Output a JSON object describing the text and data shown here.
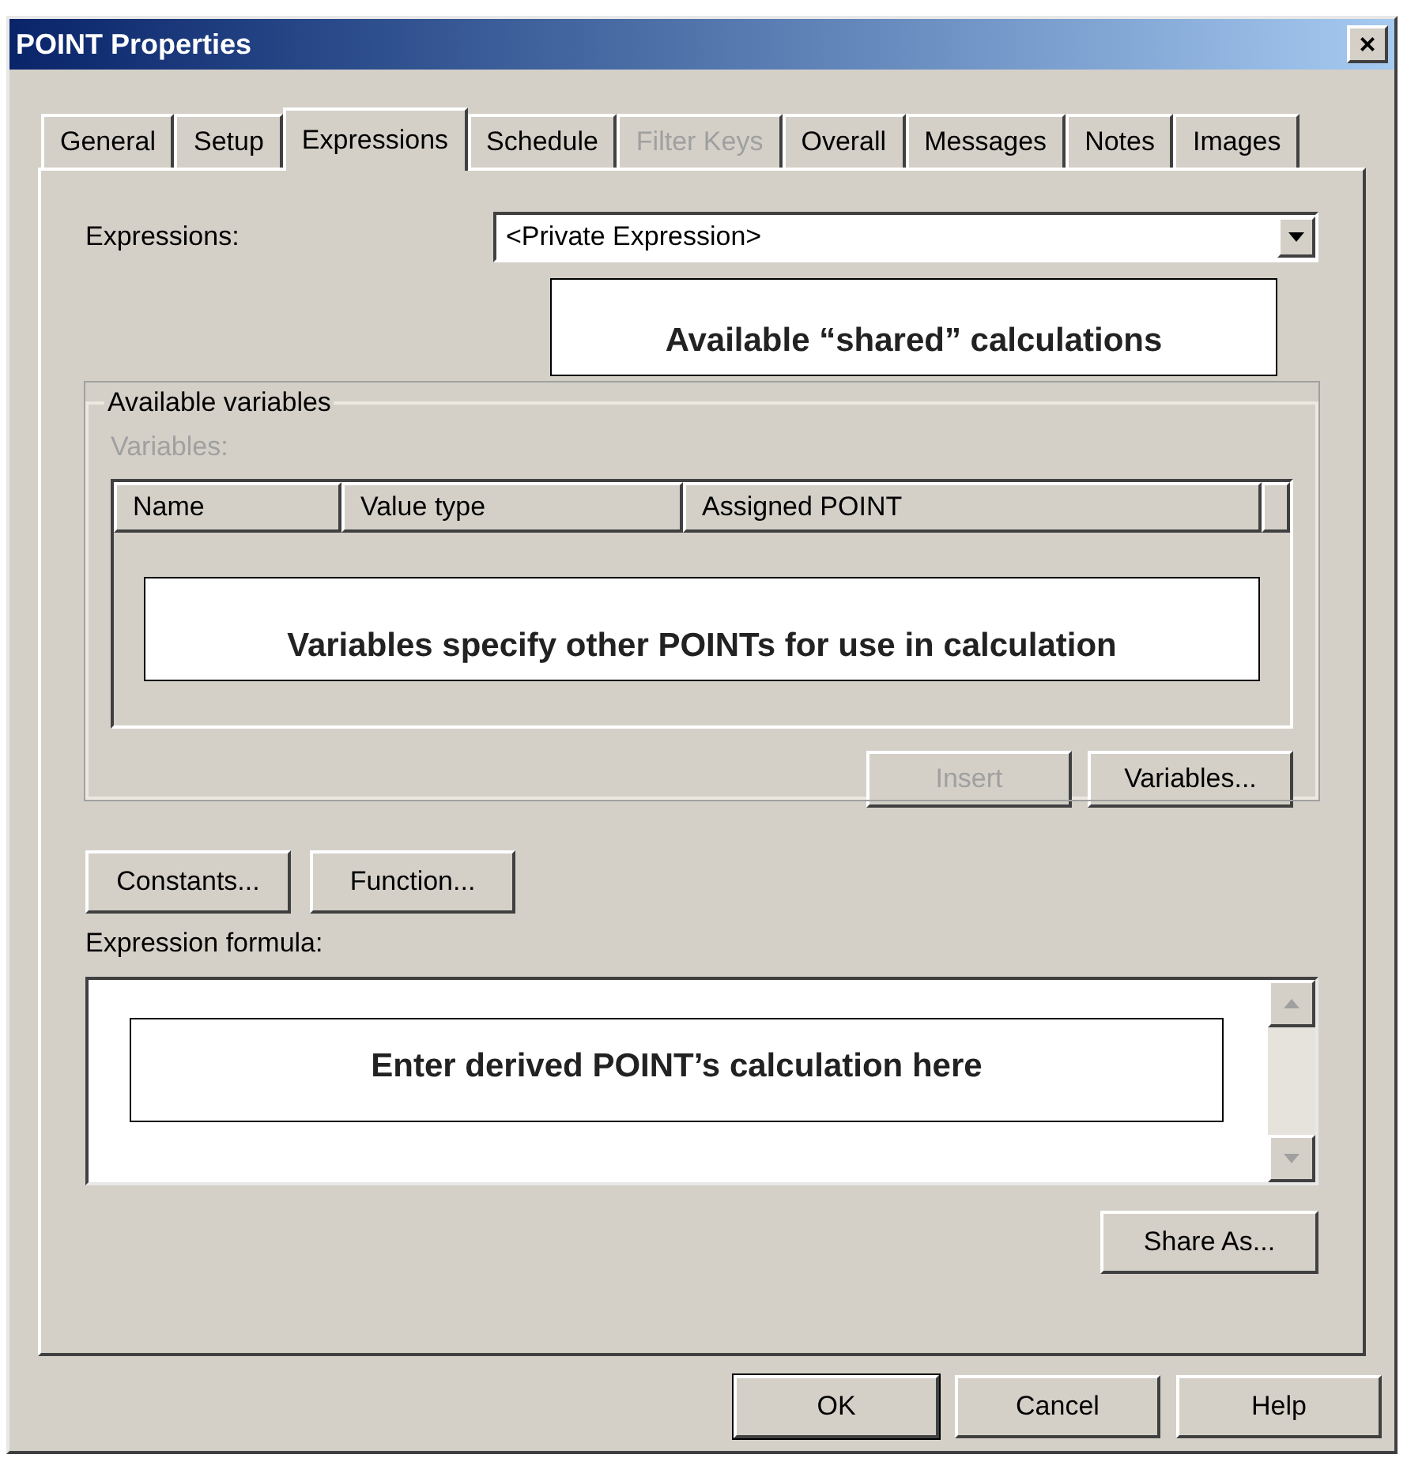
{
  "window": {
    "title": "POINT Properties",
    "close": "×"
  },
  "tabs": [
    {
      "label": "General",
      "selected": false,
      "disabled": false
    },
    {
      "label": "Setup",
      "selected": false,
      "disabled": false
    },
    {
      "label": "Expressions",
      "selected": true,
      "disabled": false
    },
    {
      "label": "Schedule",
      "selected": false,
      "disabled": false
    },
    {
      "label": "Filter Keys",
      "selected": false,
      "disabled": true
    },
    {
      "label": "Overall",
      "selected": false,
      "disabled": false
    },
    {
      "label": "Messages",
      "selected": false,
      "disabled": false
    },
    {
      "label": "Notes",
      "selected": false,
      "disabled": false
    },
    {
      "label": "Images",
      "selected": false,
      "disabled": false
    }
  ],
  "expressions": {
    "label": "Expressions:",
    "value": "<Private Expression>",
    "callout": "Available “shared” calculations"
  },
  "available_variables": {
    "title": "Available variables",
    "variables_label": "Variables:",
    "variables_disabled": true,
    "columns": [
      "Name",
      "Value type",
      "Assigned POINT"
    ],
    "callout": "Variables specify other POINTs for use in calculation",
    "buttons": [
      {
        "label": "Insert",
        "disabled": true
      },
      {
        "label": "Variables...",
        "disabled": false
      }
    ]
  },
  "formula_buttons": [
    {
      "label": "Constants..."
    },
    {
      "label": "Function..."
    }
  ],
  "expression_formula": {
    "label": "Expression formula:",
    "callout": "Enter derived POINT’s calculation here"
  },
  "share_button": "Share As...",
  "dialog_buttons": [
    {
      "label": "OK",
      "default": true
    },
    {
      "label": "Cancel",
      "default": false
    },
    {
      "label": "Help",
      "default": false
    }
  ]
}
